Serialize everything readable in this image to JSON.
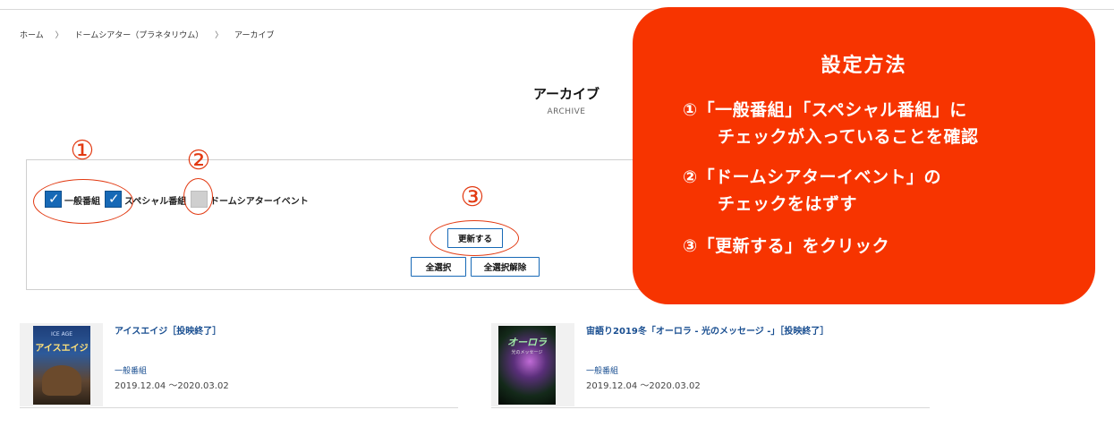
{
  "breadcrumb": [
    "ホーム",
    "ドームシアター（プラネタリウム）",
    "アーカイブ"
  ],
  "breadcrumb_separator": "〉",
  "page": {
    "title": "アーカイブ",
    "subtitle": "ARCHIVE"
  },
  "filters": {
    "items": [
      {
        "label": "一般番組",
        "checked": true
      },
      {
        "label": "スペシャル番組",
        "checked": true
      },
      {
        "label": "ドームシアターイベント",
        "checked": false
      }
    ],
    "update_button": "更新する",
    "select_all_button": "全選択",
    "deselect_all_button": "全選択解除"
  },
  "markers": [
    "①",
    "②",
    "③"
  ],
  "cards": [
    {
      "title": "アイスエイジ［投映終了］",
      "category": "一般番組",
      "date": "2019.12.04 ～2020.03.02",
      "poster_text": "アイスエイジ",
      "poster_tag": "ICE AGE"
    },
    {
      "title": "宙語り2019冬「オーロラ - 光のメッセージ -」［投映終了］",
      "category": "一般番組",
      "date": "2019.12.04 ～2020.03.02",
      "poster_text": "オーロラ",
      "poster_tag": "光のメッセージ"
    }
  ],
  "callout": {
    "title": "設定方法",
    "lines": [
      "①「一般番組」「スペシャル番組」に",
      "チェックが入っていることを確認",
      "②「ドームシアターイベント」の",
      "チェックをはずす",
      "③「更新する」をクリック"
    ]
  },
  "colors": {
    "accent_blue": "#1769b6",
    "link_blue": "#1a4f91",
    "annotation_red": "#e23a12",
    "callout_bg": "#f73400"
  }
}
